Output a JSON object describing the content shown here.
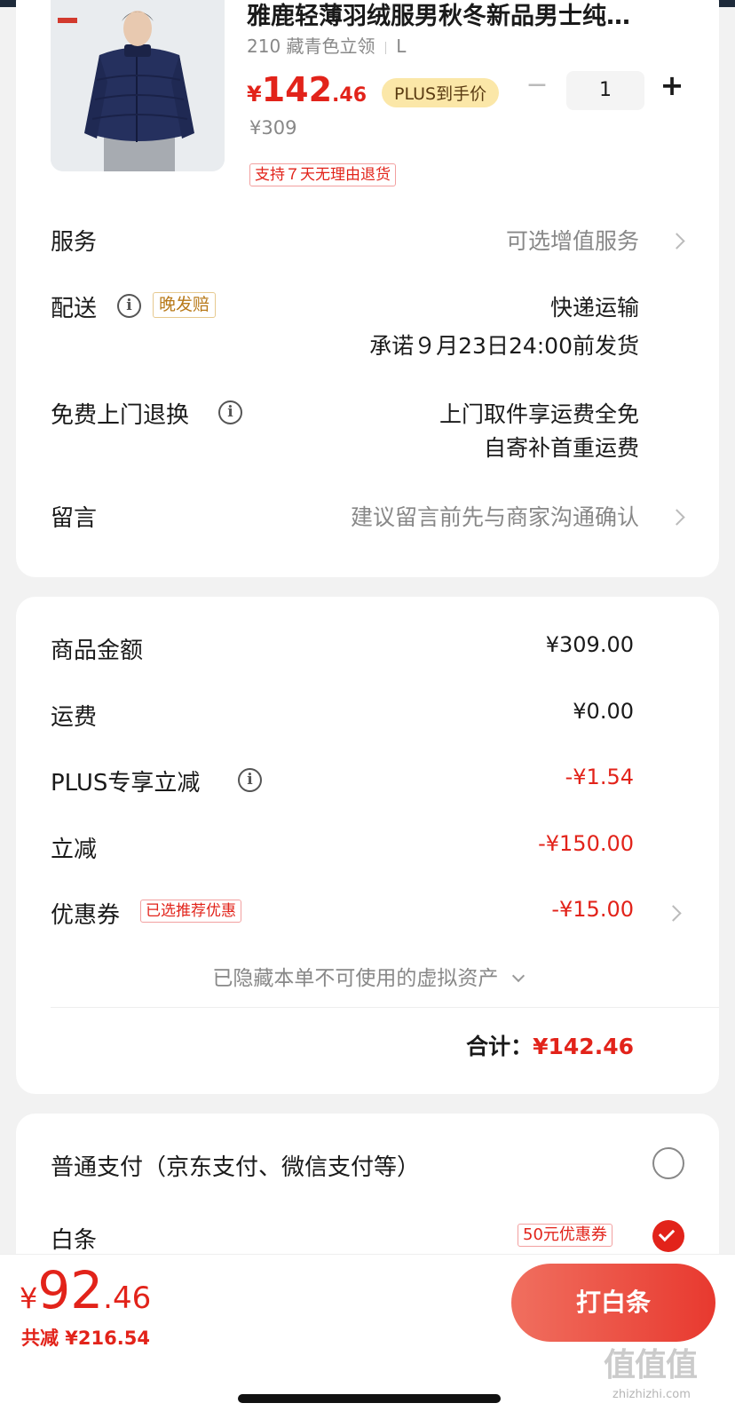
{
  "product": {
    "title": "雅鹿轻薄羽绒服男秋冬新品男士纯…",
    "variant": "210 藏青色立领",
    "size": "L",
    "price_symbol": "¥",
    "price_int": "142",
    "price_dec": ".46",
    "plus_badge": "PLUS到手价",
    "original_price": "¥309",
    "return_tag": "支持７天无理由退货",
    "quantity": "1",
    "minus_label": "−",
    "plus_label": "+"
  },
  "service": {
    "label": "服务",
    "value": "可选增值服务"
  },
  "delivery": {
    "label": "配送",
    "tag": "晚发赔",
    "method": "快递运输",
    "promise": "承诺９月23日24:00前发货"
  },
  "return_service": {
    "label": "免费上门退换",
    "line1": "上门取件享运费全免",
    "line2": "自寄补首重运费"
  },
  "message": {
    "label": "留言",
    "placeholder": "建议留言前先与商家沟通确认"
  },
  "summary": {
    "rows": [
      {
        "label": "商品金额",
        "value": "¥309.00"
      },
      {
        "label": "运费",
        "value": "¥0.00"
      },
      {
        "label": "PLUS专享立减",
        "value": "-¥1.54"
      },
      {
        "label": "立减",
        "value": "-¥150.00"
      },
      {
        "label": "优惠券",
        "value": "-¥15.00",
        "tag": "已选推荐优惠"
      }
    ],
    "hidden_assets": "已隐藏本单不可使用的虚拟资产",
    "total_label": "合计：",
    "total_value": "¥142.46"
  },
  "payment": {
    "normal_label": "普通支付（京东支付、微信支付等）",
    "baitiao_label": "白条",
    "baitiao_coupon": "50元优惠券"
  },
  "bottom_bar": {
    "price_symbol": "¥",
    "price_int": "92",
    "price_dec": ".46",
    "saved": "共减 ¥216.54",
    "submit": "打白条"
  },
  "watermark": {
    "logo": "值值值",
    "site": "zhizhizhi.com"
  },
  "colors": {
    "accent": "#e2231a",
    "plus_gold": "#fbe7a8",
    "background": "#f2f2f2"
  }
}
